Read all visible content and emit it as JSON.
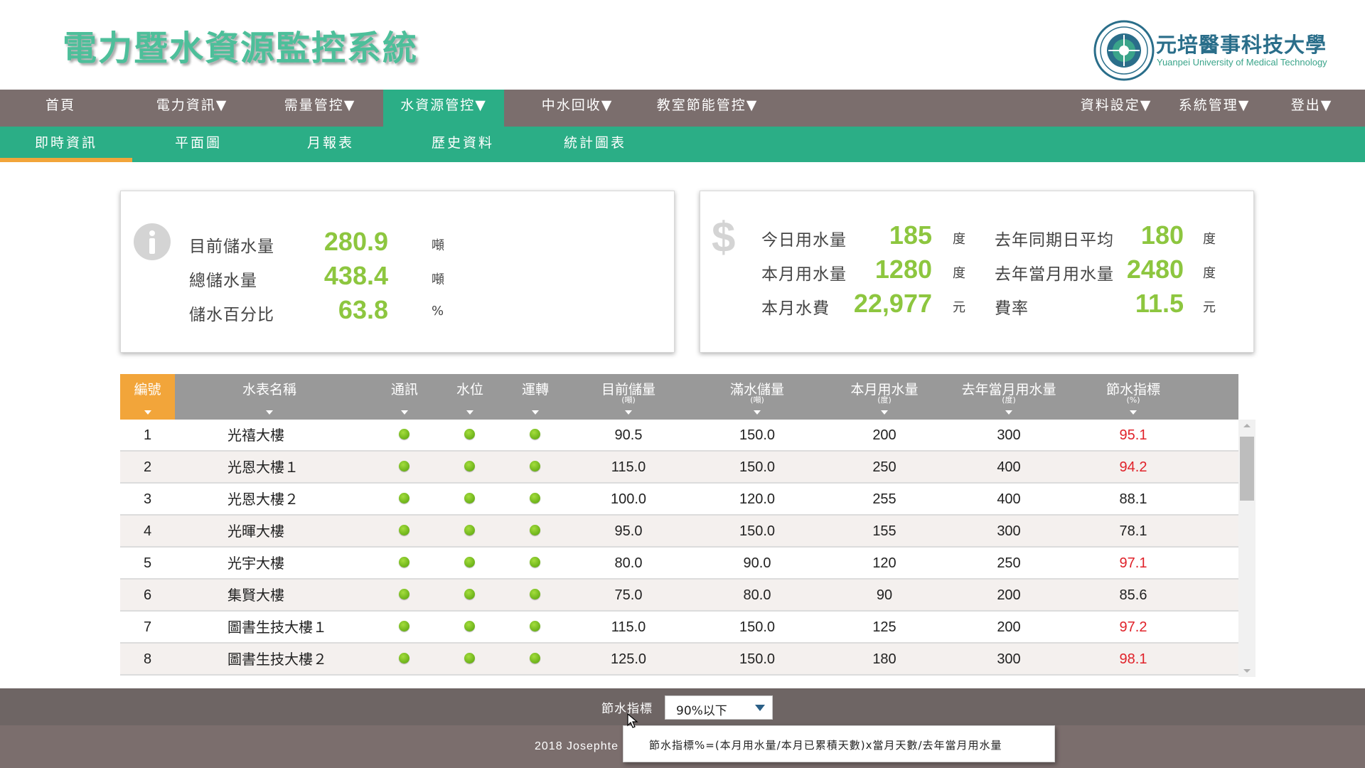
{
  "header": {
    "title": "電力暨水資源監控系統",
    "university_name": "元培醫事科技大學",
    "university_en": "Yuanpei University of Medical Technology"
  },
  "nav": {
    "items": [
      {
        "label": "首頁"
      },
      {
        "label": "電力資訊▼"
      },
      {
        "label": "需量管控▼"
      },
      {
        "label": "水資源管控▼"
      },
      {
        "label": "中水回收▼"
      },
      {
        "label": "教室節能管控▼"
      },
      {
        "label": "資料設定▼"
      },
      {
        "label": "系統管理▼"
      },
      {
        "label": "登出▼"
      }
    ],
    "active_index": 3
  },
  "subnav": {
    "items": [
      {
        "label": "即時資訊"
      },
      {
        "label": "平面圖"
      },
      {
        "label": "月報表"
      },
      {
        "label": "歷史資料"
      },
      {
        "label": "統計圖表"
      }
    ],
    "active_index": 0
  },
  "storage_card": {
    "icon": "info-icon",
    "rows": [
      {
        "label": "目前儲水量",
        "value": "280.9",
        "unit": "噸"
      },
      {
        "label": "總儲水量",
        "value": "438.4",
        "unit": "噸"
      },
      {
        "label": "儲水百分比",
        "value": "63.8",
        "unit": "%"
      }
    ]
  },
  "usage_card": {
    "icon": "dollar-icon",
    "dollar_glyph": "$",
    "left": [
      {
        "label": "今日用水量",
        "value": "185",
        "unit": "度"
      },
      {
        "label": "本月用水量",
        "value": "1280",
        "unit": "度"
      },
      {
        "label": "本月水費",
        "value": "22,977",
        "unit": "元"
      }
    ],
    "right": [
      {
        "label": "去年同期日平均",
        "value": "180",
        "unit": "度"
      },
      {
        "label": "去年當月用水量",
        "value": "2480",
        "unit": "度"
      },
      {
        "label": "費率",
        "value": "11.5",
        "unit": "元"
      }
    ]
  },
  "table": {
    "columns": [
      {
        "label": "編號",
        "unit": ""
      },
      {
        "label": "水表名稱",
        "unit": ""
      },
      {
        "label": "通訊",
        "unit": ""
      },
      {
        "label": "水位",
        "unit": ""
      },
      {
        "label": "運轉",
        "unit": ""
      },
      {
        "label": "目前儲量",
        "unit": "(噸)"
      },
      {
        "label": "滿水儲量",
        "unit": "(噸)"
      },
      {
        "label": "本月用水量",
        "unit": "(度)"
      },
      {
        "label": "去年當月用水量",
        "unit": "(度)"
      },
      {
        "label": "節水指標",
        "unit": "(%)"
      }
    ],
    "rows": [
      {
        "id": "1",
        "name": "光禧大樓",
        "current": "90.5",
        "full": "150.0",
        "month": "200",
        "last_year": "300",
        "index": "95.1",
        "alert": true
      },
      {
        "id": "2",
        "name": "光恩大樓１",
        "current": "115.0",
        "full": "150.0",
        "month": "250",
        "last_year": "400",
        "index": "94.2",
        "alert": true
      },
      {
        "id": "3",
        "name": "光恩大樓２",
        "current": "100.0",
        "full": "120.0",
        "month": "255",
        "last_year": "400",
        "index": "88.1",
        "alert": false
      },
      {
        "id": "4",
        "name": "光暉大樓",
        "current": "95.0",
        "full": "150.0",
        "month": "155",
        "last_year": "300",
        "index": "78.1",
        "alert": false
      },
      {
        "id": "5",
        "name": "光宇大樓",
        "current": "80.0",
        "full": "90.0",
        "month": "120",
        "last_year": "250",
        "index": "97.1",
        "alert": true
      },
      {
        "id": "6",
        "name": "集賢大樓",
        "current": "75.0",
        "full": "80.0",
        "month": "90",
        "last_year": "200",
        "index": "85.6",
        "alert": false
      },
      {
        "id": "7",
        "name": "圖書生技大樓１",
        "current": "115.0",
        "full": "150.0",
        "month": "125",
        "last_year": "200",
        "index": "97.2",
        "alert": true
      },
      {
        "id": "8",
        "name": "圖書生技大樓２",
        "current": "125.0",
        "full": "150.0",
        "month": "180",
        "last_year": "300",
        "index": "98.1",
        "alert": true
      }
    ]
  },
  "filter": {
    "label": "節水指標",
    "selected": "90%以下"
  },
  "footer": {
    "copyright": "2018 Josephte"
  },
  "tooltip": {
    "text": "節水指標%=(本月用水量/本月已累積天數)x當月天數/去年當月用水量"
  },
  "colors": {
    "accent_green": "#2bae86",
    "nav_gray": "#7b6e6d",
    "value_green": "#8dc63f",
    "alert_red": "#e0222a",
    "sort_orange": "#f2a53a"
  }
}
